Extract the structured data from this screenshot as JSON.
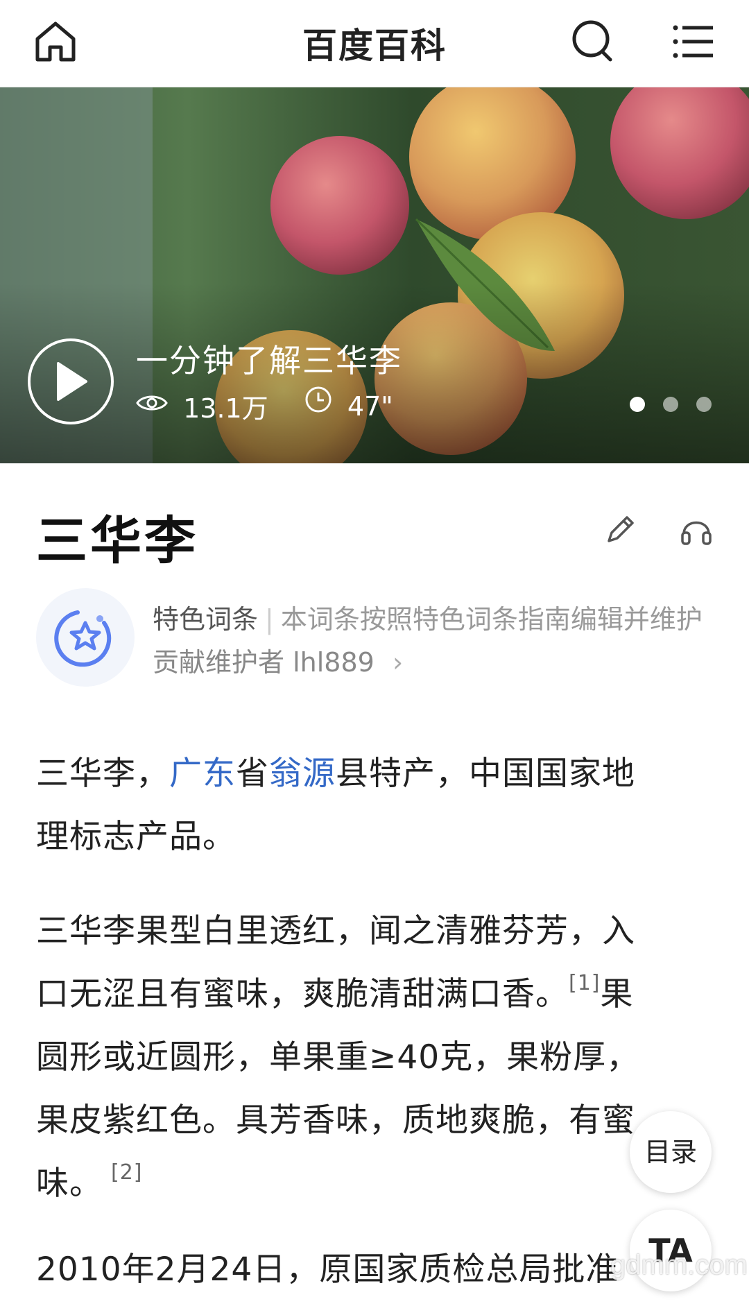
{
  "header": {
    "title": "百度百科"
  },
  "hero": {
    "video_title": "一分钟了解三华李",
    "views": "13.1万",
    "duration": "47\"",
    "slide_count": 3,
    "active_slide": 0
  },
  "entry": {
    "title": "三华李",
    "featured_label": "特色词条",
    "featured_desc": "本词条按照特色词条指南编辑并维护",
    "contributor_prefix": "贡献维护者",
    "contributor_name": "lhl889"
  },
  "paragraphs": {
    "p1": {
      "a": "三华李，",
      "link1": "广东",
      "b": "省",
      "link2": "翁源",
      "c": "县特产，中国国家地",
      "line2": "理标志产品。"
    },
    "p2": {
      "line1": "三华李果型白里透红，闻之清雅芬芳，入",
      "line2a": "口无涩且有蜜味，爽脆清甜满口香。",
      "ref1": "[1]",
      "line2b": "果",
      "line3": "圆形或近圆形，单果重≥40克，果粉厚，",
      "line4": "果皮紫红色。具芳香味，质地爽脆，有蜜",
      "line5": "味。",
      "ref2": "[2]"
    },
    "p3": {
      "line1": "2010年2月24日，原国家质检总局批准"
    }
  },
  "floating": {
    "toc_label": "目录",
    "ta_label": "TA"
  },
  "watermark": "gdmm.com",
  "colors": {
    "link": "#3469c7",
    "hero_green": "#3d5b3a"
  }
}
